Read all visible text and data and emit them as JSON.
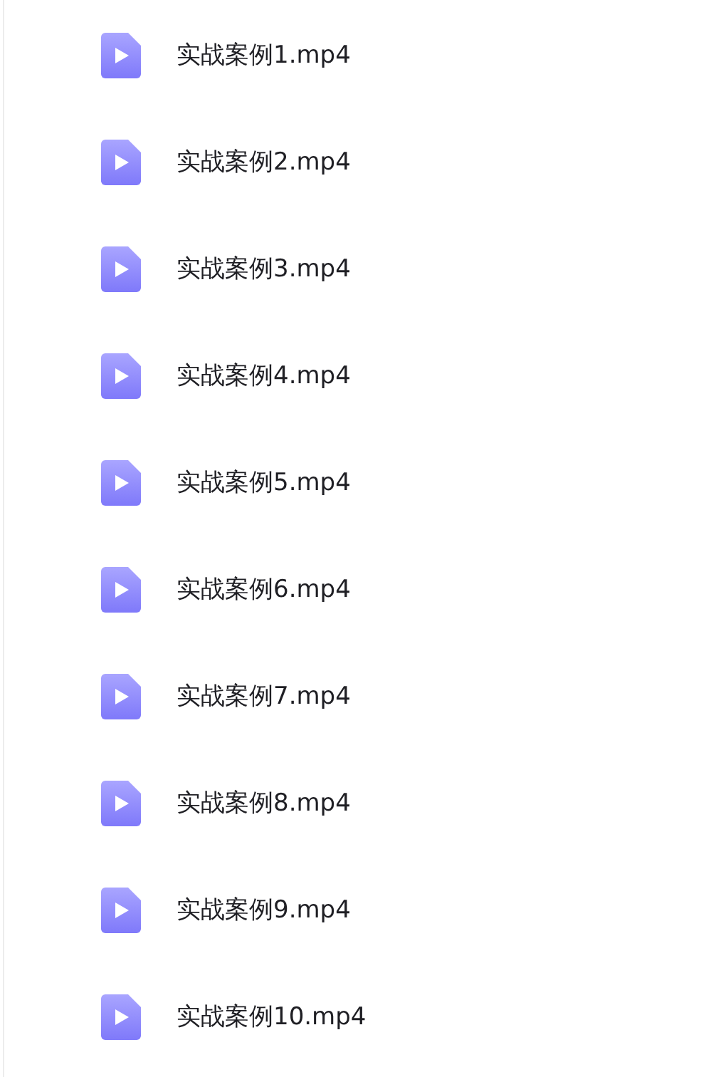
{
  "files": [
    {
      "name": "实战案例1.mp4"
    },
    {
      "name": "实战案例2.mp4"
    },
    {
      "name": "实战案例3.mp4"
    },
    {
      "name": "实战案例4.mp4"
    },
    {
      "name": "实战案例5.mp4"
    },
    {
      "name": "实战案例6.mp4"
    },
    {
      "name": "实战案例7.mp4"
    },
    {
      "name": "实战案例8.mp4"
    },
    {
      "name": "实战案例9.mp4"
    },
    {
      "name": "实战案例10.mp4"
    }
  ]
}
